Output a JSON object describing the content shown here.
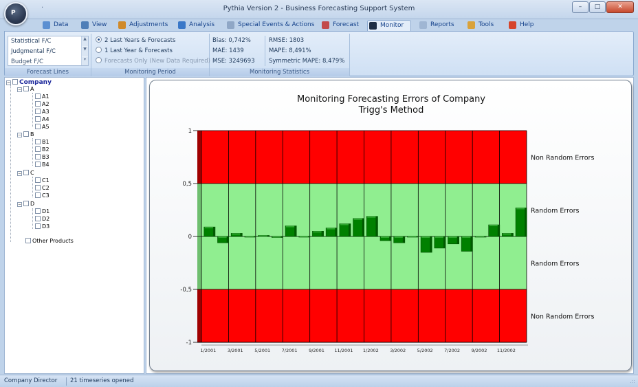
{
  "window": {
    "title": "Pythia Version 2 - Business Forecasting Support System",
    "orb_label": "P",
    "qat": "·",
    "minimize": "–",
    "maximize": "□",
    "close": "✕"
  },
  "tabs": [
    {
      "label": "Data",
      "icon": "data-icon",
      "color": "#5b8fd1"
    },
    {
      "label": "View",
      "icon": "view-icon",
      "color": "#4f7fb8"
    },
    {
      "label": "Adjustments",
      "icon": "adjustments-icon",
      "color": "#d08a2a"
    },
    {
      "label": "Analysis",
      "icon": "analysis-icon",
      "color": "#3a78c8"
    },
    {
      "label": "Special Events & Actions",
      "icon": "events-icon",
      "color": "#8fa7c6"
    },
    {
      "label": "Forecast",
      "icon": "forecast-icon",
      "color": "#c24a4a"
    },
    {
      "label": "Monitor",
      "icon": "monitor-icon",
      "color": "#1e2e45",
      "active": true
    },
    {
      "label": "Reports",
      "icon": "reports-icon",
      "color": "#9fb6d3"
    },
    {
      "label": "Tools",
      "icon": "tools-icon",
      "color": "#d9a23a"
    },
    {
      "label": "Help",
      "icon": "help-icon",
      "color": "#d6452c"
    }
  ],
  "ribbon": {
    "forecast_lines": {
      "items": [
        "Statistical F/C",
        "Judgmental F/C",
        "Budget F/C"
      ],
      "label": "Forecast Lines"
    },
    "monitoring_period": {
      "options": [
        {
          "label": "2 Last Years & Forecasts",
          "selected": true,
          "enabled": true
        },
        {
          "label": "1 Last Year & Forecasts",
          "selected": false,
          "enabled": true
        },
        {
          "label": "Forecasts Only (New Data Required)",
          "selected": false,
          "enabled": false
        }
      ],
      "label": "Monitoring Period"
    },
    "monitoring_statistics": {
      "left": [
        "Bias: 0,742%",
        "MAE: 1439",
        "MSE: 3249693"
      ],
      "right": [
        "RMSE: 1803",
        "MAPE: 8,491%",
        "Symmetric MAPE: 8,479%"
      ],
      "label": "Monitoring Statistics"
    }
  },
  "tree": {
    "root": "Company",
    "groups": [
      {
        "label": "A",
        "children": [
          "A1",
          "A2",
          "A3",
          "A4",
          "A5"
        ]
      },
      {
        "label": "B",
        "children": [
          "B1",
          "B2",
          "B3",
          "B4"
        ]
      },
      {
        "label": "C",
        "children": [
          "C1",
          "C2",
          "C3"
        ]
      },
      {
        "label": "D",
        "children": [
          "D1",
          "D2",
          "D3"
        ]
      }
    ],
    "other": "Other Products"
  },
  "chart_data": {
    "type": "bar",
    "title": "Monitoring Forecasting Errors of Company",
    "subtitle": "Trigg's Method",
    "ylim": [
      -1,
      1
    ],
    "yticks": [
      "1",
      "0,5",
      "0",
      "-0,5",
      "-1"
    ],
    "ytick_values": [
      1,
      0.5,
      0,
      -0.5,
      -1
    ],
    "categories": [
      "1/2001",
      "2/2001",
      "3/2001",
      "4/2001",
      "5/2001",
      "6/2001",
      "7/2001",
      "8/2001",
      "9/2001",
      "10/2001",
      "11/2001",
      "12/2001",
      "1/2002",
      "2/2002",
      "3/2002",
      "4/2002",
      "5/2002",
      "6/2002",
      "7/2002",
      "8/2002",
      "9/2002",
      "10/2002",
      "11/2002",
      "12/2002"
    ],
    "xtick_labels": [
      "1/2001",
      "3/2001",
      "5/2001",
      "7/2001",
      "9/2001",
      "11/2001",
      "1/2002",
      "3/2002",
      "5/2002",
      "7/2002",
      "9/2002",
      "11/2002"
    ],
    "values": [
      0.09,
      -0.06,
      0.03,
      0.0,
      0.01,
      -0.01,
      0.1,
      0.0,
      0.05,
      0.08,
      0.12,
      0.17,
      0.19,
      -0.04,
      -0.06,
      0.0,
      -0.15,
      -0.11,
      -0.07,
      -0.14,
      0.0,
      0.11,
      0.03,
      0.27
    ],
    "bands": [
      {
        "from": 0.5,
        "to": 1,
        "label": "Non Random Errors",
        "color": "#ff0000"
      },
      {
        "from": 0,
        "to": 0.5,
        "label": "Random Errors",
        "color": "#90ee90"
      },
      {
        "from": -0.5,
        "to": 0,
        "label": "Random Errors",
        "color": "#90ee90"
      },
      {
        "from": -1,
        "to": -0.5,
        "label": "Non Random Errors",
        "color": "#ff0000"
      }
    ],
    "bar_color": "#008000",
    "grid": true
  },
  "status": {
    "user": "Company Director",
    "info": "21 timeseries opened",
    "grip": ".::"
  }
}
